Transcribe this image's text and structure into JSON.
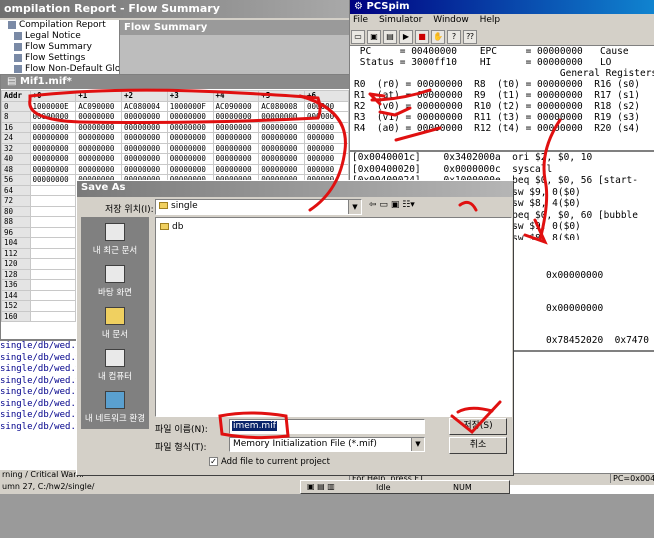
{
  "quartus": {
    "title": "ompilation Report - Flow Summary",
    "tree": [
      "Compilation Report",
      "Legal Notice",
      "Flow Summary",
      "Flow Settings",
      "Flow Non-Default Global"
    ],
    "flow_header": "Flow Summary",
    "mif_title": "Mif1.mif*",
    "grid_header": [
      "Addr",
      "+0",
      "+1",
      "+2",
      "+3",
      "+4",
      "+5",
      "+6"
    ],
    "rows": [
      {
        "addr": "0",
        "cells": [
          "1000000E",
          "AC090000",
          "AC080004",
          "1000000F",
          "AC090000",
          "AC080008",
          "000000"
        ]
      },
      {
        "addr": "8",
        "cells": [
          "00000000",
          "00000000",
          "00000000",
          "00000000",
          "00000000",
          "00000000",
          "000000"
        ]
      },
      {
        "addr": "16",
        "cells": [
          "00000000",
          "00000000",
          "00000000",
          "00000000",
          "00000000",
          "00000000",
          "000000"
        ]
      },
      {
        "addr": "24",
        "cells": [
          "00000000",
          "00000000",
          "00000000",
          "00000000",
          "00000000",
          "00000000",
          "000000"
        ]
      },
      {
        "addr": "32",
        "cells": [
          "00000000",
          "00000000",
          "00000000",
          "00000000",
          "00000000",
          "00000000",
          "000000"
        ]
      },
      {
        "addr": "40",
        "cells": [
          "00000000",
          "00000000",
          "00000000",
          "00000000",
          "00000000",
          "00000000",
          "000000"
        ]
      },
      {
        "addr": "48",
        "cells": [
          "00000000",
          "00000000",
          "00000000",
          "00000000",
          "00000000",
          "00000000",
          "000000"
        ]
      },
      {
        "addr": "56",
        "cells": [
          "00000000",
          "00000000",
          "00000000",
          "00000000",
          "00000000",
          "00000000",
          "000000"
        ]
      },
      {
        "addr": "64",
        "cells": [
          "",
          "",
          "",
          "",
          "",
          "",
          ""
        ]
      },
      {
        "addr": "72",
        "cells": [
          "",
          "",
          "",
          "",
          "",
          "",
          ""
        ]
      },
      {
        "addr": "80",
        "cells": [
          "",
          "",
          "",
          "",
          "",
          "",
          ""
        ]
      },
      {
        "addr": "88",
        "cells": [
          "",
          "",
          "",
          "",
          "",
          "",
          ""
        ]
      },
      {
        "addr": "96",
        "cells": [
          "",
          "",
          "",
          "",
          "",
          "",
          ""
        ]
      },
      {
        "addr": "104",
        "cells": [
          "",
          "",
          "",
          "",
          "",
          "",
          ""
        ]
      },
      {
        "addr": "112",
        "cells": [
          "",
          "",
          "",
          "",
          "",
          "",
          ""
        ]
      },
      {
        "addr": "120",
        "cells": [
          "",
          "",
          "",
          "",
          "",
          "",
          ""
        ]
      },
      {
        "addr": "128",
        "cells": [
          "",
          "",
          "",
          "",
          "",
          "",
          ""
        ]
      },
      {
        "addr": "136",
        "cells": [
          "",
          "",
          "",
          "",
          "",
          "",
          ""
        ]
      },
      {
        "addr": "144",
        "cells": [
          "",
          "",
          "",
          "",
          "",
          "",
          ""
        ]
      },
      {
        "addr": "152",
        "cells": [
          "",
          "",
          "",
          "",
          "",
          "",
          ""
        ]
      },
      {
        "addr": "160",
        "cells": [
          "",
          "",
          "",
          "",
          "",
          "",
          ""
        ]
      }
    ],
    "messages": [
      "single/db/wed.wsf",
      "single/db/wed.wsf",
      "single/db/wed.wsf",
      "single/db/wed.wsf",
      "single/db/wed.wsf",
      "single/db/wed.wsf",
      "single/db/wed.wsf",
      "single/db/wed.wsf"
    ],
    "tabs": "rning  /  Critical Warni",
    "status": "umn 27, C:/hw2/single/"
  },
  "pcspim": {
    "title": "PCSpim",
    "menu": [
      "File",
      "Simulator",
      "Window",
      "Help"
    ],
    "regs": [
      " PC     = 00400000    EPC     = 00000000   Cause",
      " Status = 3000ff10    HI      = 00000000   LO",
      "                                    General Registers",
      "R0  (r0) = 00000000  R8  (t0) = 00000000  R16 (s0)",
      "R1  (at) = 00000000  R9  (t1) = 00000000  R17 (s1)",
      "R2  (v0) = 00000000  R10 (t2) = 00000000  R18 (s2)",
      "R3  (v1) = 00000000  R11 (t3) = 00000000  R19 (s3)",
      "R4  (a0) = 00000000  R12 (t4) = 00000000  R20 (s4)"
    ],
    "code": [
      "[0x0040001c]    0x3402000a  ori $2, $0, 10",
      "[0x00400020]    0x0000000c  syscall",
      "[0x00400024]    0x1000000e  beq $0, $0, 56 [start-",
      "                            sw $9, 0($0)",
      "                            sw $8, 4($0)",
      "                            beq $0, $0, 60 [bubble",
      "                            sw $9, 0($0)",
      "                            sw $8, 8($0)"
    ],
    "data": [
      "0x00000000",
      "0x00000000",
      "0x78452020  0x7470"
    ],
    "msgs": [
      "    s R. Larus (larus@cs.w",
      "",
      "   vid A. Carley (dac@cs.w",
      "   ufmann Publishers, Inc.",
      "   all copyright notice.",
      "   Spim\\exceptions.s",
      "   blesort_without_j.asm s"
    ],
    "status_help": "For Help, press F1",
    "status_pc": "PC=0x004"
  },
  "dialog": {
    "title": "Save As",
    "lookin_label": "저장 위치(I):",
    "lookin_value": "single",
    "places": [
      "내 최근 문서",
      "바탕 화면",
      "내 문서",
      "내 컴퓨터",
      "내 네트워크 환경"
    ],
    "files": [
      "db"
    ],
    "filename_label": "파일 이름(N):",
    "filename_value": "imem.mif",
    "filetype_label": "파일 형식(T):",
    "filetype_value": "Memory Initialization File (*.mif)",
    "save_button": "저장(S)",
    "cancel_button": "취소",
    "add_file_label": "Add file to current project"
  },
  "misc": {
    "idle": "Idle",
    "num": "NUM"
  }
}
